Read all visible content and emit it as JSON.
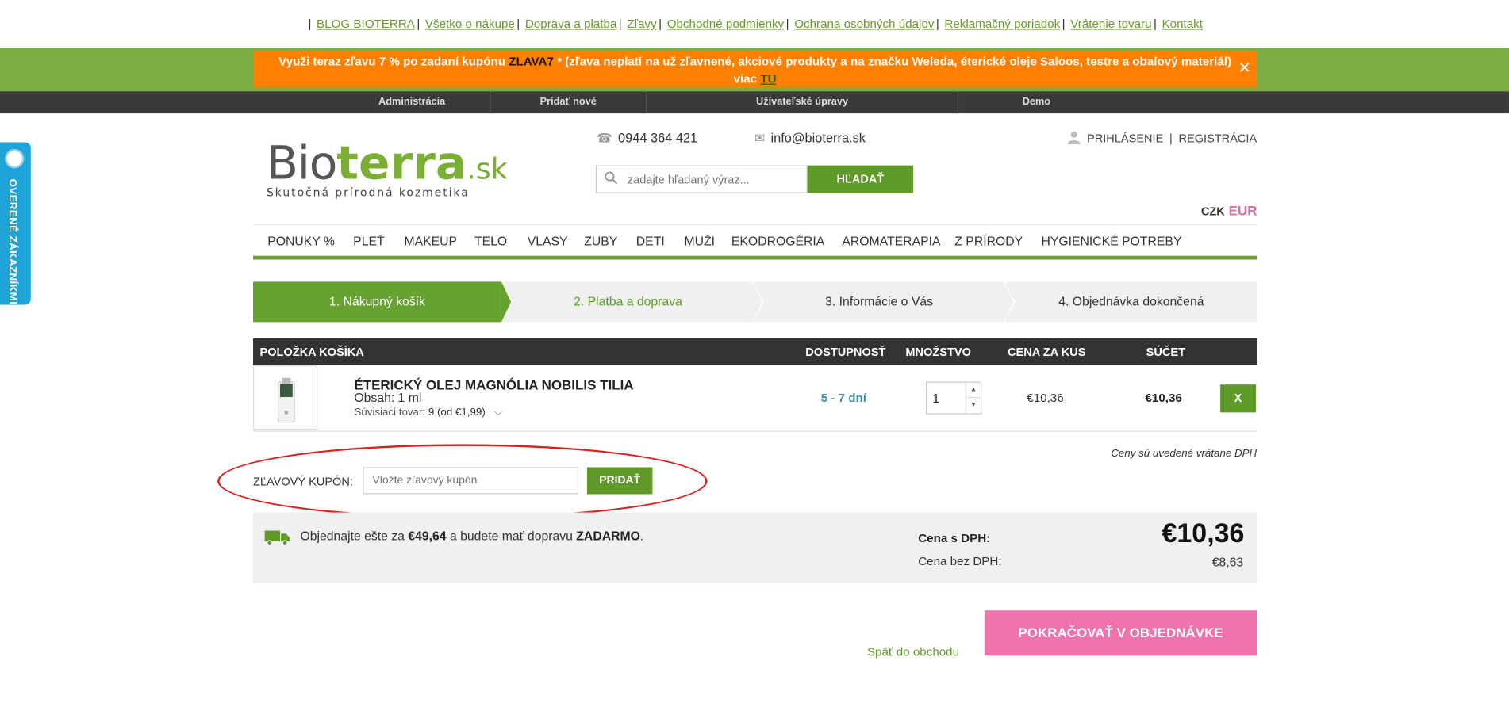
{
  "top_links": [
    "BLOG BIOTERRA",
    "Všetko o nákupe",
    "Doprava a platba",
    "Zľavy",
    "Obchodné podmienky",
    "Ochrana osobných údajov",
    "Reklamačný poriadok",
    "Vrátenie tovaru",
    "Kontakt"
  ],
  "promo": {
    "text_before": "Využi teraz zľavu 7 % po zadaní kupónu ",
    "code": "ZLAVA7",
    "text_after": " * (zľava neplatí na už zľavnené, akciové produkty a na značku Weleda, éterické oleje Saloos, testre a obalový materiál)",
    "more_prefix": "viac ",
    "more_link": "TU",
    "close": "✕"
  },
  "admin_bar": [
    "Administrácia",
    "Pridať nové",
    "Užívateľské úpravy",
    "Demo"
  ],
  "logo": {
    "bio": "Bio",
    "terra": "terra",
    "sk": ".sk",
    "slogan": "Skutočná prírodná kozmetika"
  },
  "contact": {
    "phone": "0944 364 421",
    "email": "info@bioterra.sk"
  },
  "search": {
    "placeholder": "zadajte hľadaný výraz...",
    "button": "HĽADAŤ"
  },
  "account": {
    "login": "PRIHLÁSENIE",
    "separator": "|",
    "register": "REGISTRÁCIA"
  },
  "currency": {
    "czk": "CZK",
    "eur": "EUR"
  },
  "main_nav": [
    "PONUKY %",
    "PLEŤ",
    "MAKEUP",
    "TELO",
    "VLASY",
    "ZUBY",
    "DETI",
    "MUŽI",
    "EKODROGÉRIA",
    "AROMATERAPIA",
    "Z PRÍRODY",
    "HYGIENICKÉ POTREBY"
  ],
  "steps": [
    "1. Nákupný košík",
    "2. Platba a doprava",
    "3. Informácie o Vás",
    "4. Objednávka dokončená"
  ],
  "table_headers": {
    "item": "POLOŽKA KOŠÍKA",
    "availability": "DOSTUPNOSŤ",
    "quantity": "MNOŽSTVO",
    "unit_price": "CENA ZA KUS",
    "total": "SÚČET"
  },
  "cart_item": {
    "name": "ÉTERICKÝ OLEJ MAGNÓLIA NOBILIS TILIA",
    "content": "Obsah: 1 ml",
    "related_label": "Súvisiaci tovar:",
    "related_value": "9 (od €1,99)",
    "availability": "5 - 7 dní",
    "quantity": "1",
    "unit_price": "€10,36",
    "total": "€10,36",
    "remove": "X"
  },
  "vat_note": "Ceny sú uvedené vrátane DPH",
  "coupon": {
    "label": "ZĽAVOVÝ KUPÓN:",
    "placeholder": "Vložte zľavový kupón",
    "button": "PRIDAŤ"
  },
  "shipping": {
    "prefix": "Objednajte ešte za ",
    "amount": "€49,64",
    "middle": " a budete mať dopravu ",
    "free": "ZADARMO",
    "suffix": "."
  },
  "totals": {
    "with_vat_label": "Cena s DPH:",
    "with_vat": "€10,36",
    "without_vat_label": "Cena bez DPH:",
    "without_vat": "€8,63"
  },
  "footer_actions": {
    "back": "Späť do obchodu",
    "continue": "POKRAČOVAŤ V OBJEDNÁVKE"
  },
  "side_tab": {
    "text": "OVERENÉ ZÁKAZNÍKMI"
  },
  "colors": {
    "green": "#5f9a28",
    "orange": "#ff7f00",
    "pink": "#ef72ae",
    "dark": "#333333",
    "blue": "#1fa4d9"
  }
}
